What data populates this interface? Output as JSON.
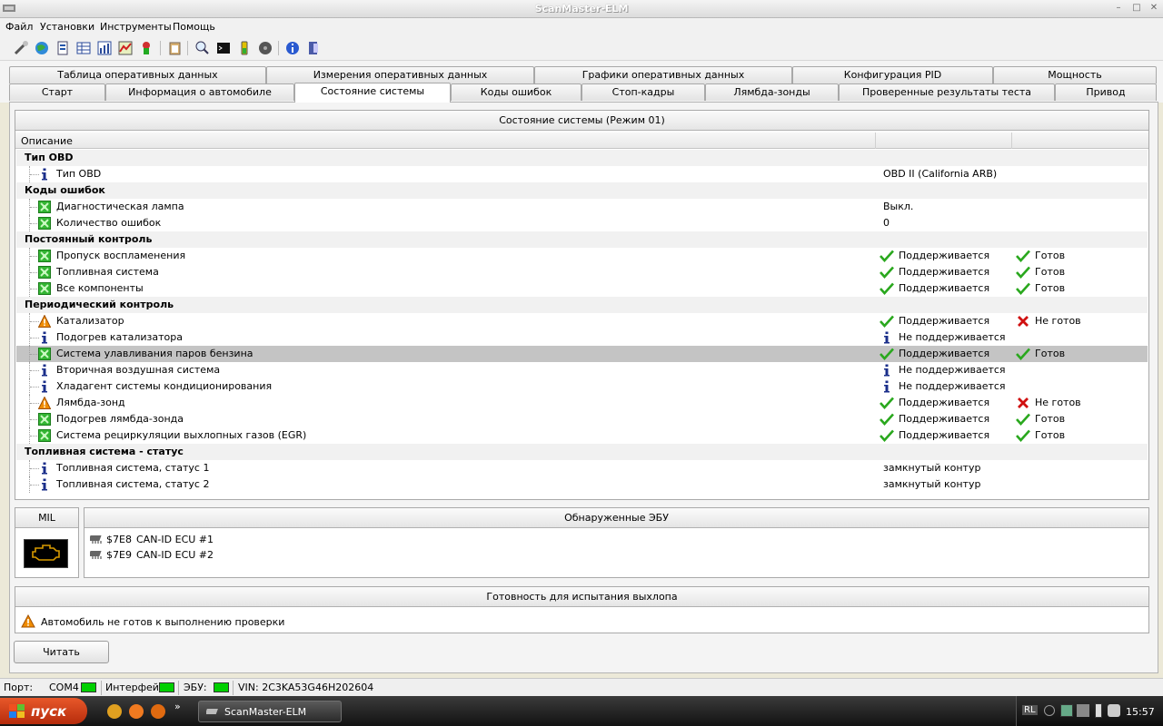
{
  "window": {
    "title": "ScanMaster-ELM"
  },
  "menu": [
    "Файл",
    "Установки",
    "Инструменты",
    "Помощь"
  ],
  "tabs_row1": [
    "Таблица оперативных данных",
    "Измерения оперативных данных",
    "Графики оперативных данных",
    "Конфигурация PID",
    "Мощность"
  ],
  "tabs_row2": [
    "Старт",
    "Информация о автомобиле",
    "Состояние системы",
    "Коды ошибок",
    "Стоп-кадры",
    "Лямбда-зонды",
    "Проверенные результаты теста",
    "Привод"
  ],
  "active_tab": "Состояние системы",
  "status_panel": {
    "caption": "Состояние системы (Режим 01)",
    "column_description": "Описание",
    "groups": [
      {
        "title": "Тип OBD",
        "rows": [
          {
            "icon": "info",
            "label": "Тип OBD",
            "value": "OBD II (California ARB)"
          }
        ]
      },
      {
        "title": "Коды ошибок",
        "rows": [
          {
            "icon": "green",
            "label": "Диагностическая лампа",
            "value": "Выкл."
          },
          {
            "icon": "green",
            "label": "Количество ошибок",
            "value": "0"
          }
        ]
      },
      {
        "title": "Постоянный контроль",
        "rows": [
          {
            "icon": "green",
            "label": "Пропуск воспламенения",
            "support": "Поддерживается",
            "support_mark": "check",
            "ready": "Готов",
            "ready_mark": "check"
          },
          {
            "icon": "green",
            "label": "Топливная система",
            "support": "Поддерживается",
            "support_mark": "check",
            "ready": "Готов",
            "ready_mark": "check"
          },
          {
            "icon": "green",
            "label": "Все компоненты",
            "support": "Поддерживается",
            "support_mark": "check",
            "ready": "Готов",
            "ready_mark": "check"
          }
        ]
      },
      {
        "title": "Периодический контроль",
        "rows": [
          {
            "icon": "warn",
            "label": "Катализатор",
            "support": "Поддерживается",
            "support_mark": "check",
            "ready": "Не готов",
            "ready_mark": "cross"
          },
          {
            "icon": "info",
            "label": "Подогрев катализатора",
            "support": "Не поддерживается",
            "support_mark": "info"
          },
          {
            "icon": "green",
            "label": "Система улавливания паров бензина",
            "support": "Поддерживается",
            "support_mark": "check",
            "ready": "Готов",
            "ready_mark": "check",
            "selected": true
          },
          {
            "icon": "info",
            "label": "Вторичная воздушная система",
            "support": "Не поддерживается",
            "support_mark": "info"
          },
          {
            "icon": "info",
            "label": "Хладагент системы кондиционирования",
            "support": "Не поддерживается",
            "support_mark": "info"
          },
          {
            "icon": "warn",
            "label": "Лямбда-зонд",
            "support": "Поддерживается",
            "support_mark": "check",
            "ready": "Не готов",
            "ready_mark": "cross"
          },
          {
            "icon": "green",
            "label": "Подогрев лямбда-зонда",
            "support": "Поддерживается",
            "support_mark": "check",
            "ready": "Готов",
            "ready_mark": "check"
          },
          {
            "icon": "green",
            "label": "Система рециркуляции выхлопных газов (EGR)",
            "support": "Поддерживается",
            "support_mark": "check",
            "ready": "Готов",
            "ready_mark": "check"
          }
        ]
      },
      {
        "title": "Топливная система - статус",
        "rows": [
          {
            "icon": "info",
            "label": "Топливная система, статус 1",
            "value": "замкнутый контур"
          },
          {
            "icon": "info",
            "label": "Топливная система, статус 2",
            "value": "замкнутый контур"
          }
        ]
      }
    ]
  },
  "mil": {
    "caption": "MIL",
    "lamp_color": "#d89a00"
  },
  "ecu": {
    "caption": "Обнаруженные ЭБУ",
    "items": [
      {
        "id": "$7E8",
        "name": "CAN-ID ECU #1"
      },
      {
        "id": "$7E9",
        "name": "CAN-ID ECU #2"
      }
    ]
  },
  "readiness": {
    "caption": "Готовность для испытания выхлопа",
    "message": "Автомобиль не готов к выполнению проверки"
  },
  "read_button": "Читать",
  "statusbar": {
    "port_label": "Порт:",
    "port_value": "COM4",
    "interface_label": "Интерфейс:",
    "ecu_label": "ЭБУ:",
    "vin": "VIN: 2C3KA53G46H202604"
  },
  "taskbar": {
    "start_label": "пуск",
    "task_label": "ScanMaster-ELM",
    "tray_lang": "RL",
    "clock": "15:57",
    "quick_launch_more": "»"
  },
  "colors": {
    "check_green": "#2aa81e",
    "cross_red": "#d01010",
    "warn_orange": "#f08c00",
    "info_blue": "#1a2e8a",
    "green_icon": "#33b533",
    "led_green": "#00d000"
  }
}
